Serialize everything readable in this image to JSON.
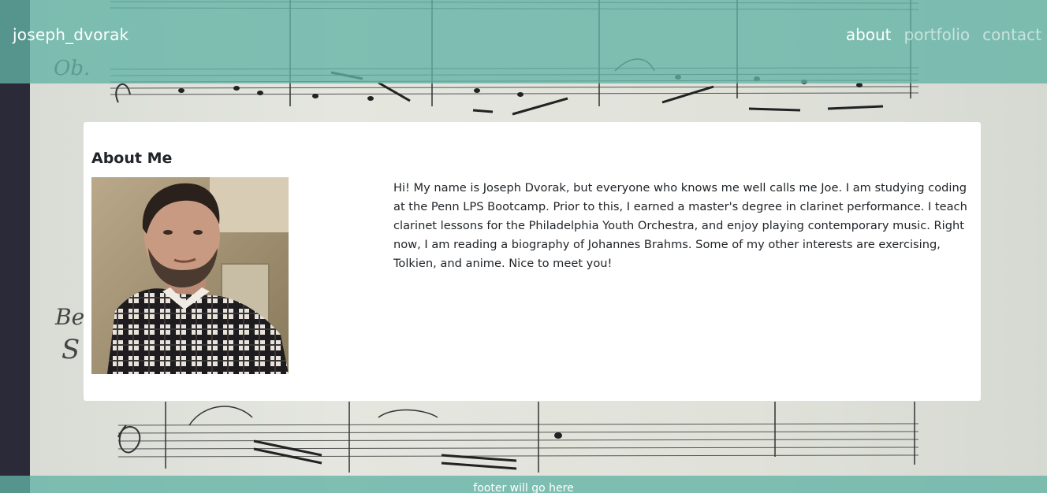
{
  "navbar": {
    "brand": "joseph_dvorak",
    "links": [
      {
        "label": "about",
        "active": true
      },
      {
        "label": "portfolio",
        "active": false
      },
      {
        "label": "contact",
        "active": false
      }
    ]
  },
  "about": {
    "title": "About Me",
    "paragraph": "Hi! My name is Joseph Dvorak, but everyone who knows me well calls me Joe. I am studying coding at the Penn LPS Bootcamp. Prior to this, I earned a master's degree in clarinet performance. I teach clarinet lessons for the Philadelphia Youth Orchestra, and enjoy playing contemporary music. Right now, I am reading a biography of Johannes Brahms. Some of my other interests are exercising, Tolkien, and anime. Nice to meet you!"
  },
  "footer": {
    "text": "footer will go here"
  },
  "colors": {
    "accent": "#62b4a5",
    "card_bg": "#ffffff",
    "text": "#212529"
  }
}
